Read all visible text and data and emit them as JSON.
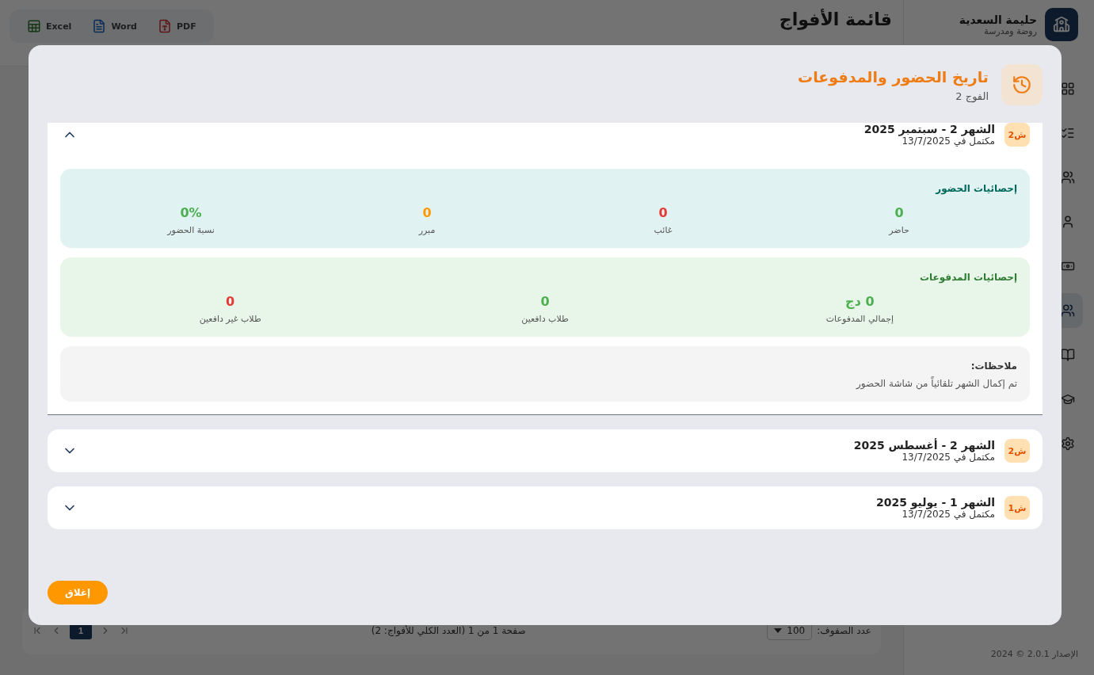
{
  "sidebar": {
    "title": "حليمة السعدية",
    "subtitle": "روضة ومدرسة",
    "items": [
      {
        "selected": false
      },
      {
        "selected": false
      },
      {
        "selected": false
      },
      {
        "selected": false
      },
      {
        "selected": false
      },
      {
        "selected": true
      },
      {
        "selected": false
      },
      {
        "selected": false
      },
      {
        "selected": false
      }
    ],
    "footer": "الإصدار 2.0.1 © 2024"
  },
  "page": {
    "title": "قائمة الأفواج",
    "exports": [
      {
        "label": "PDF",
        "kind": "pdf"
      },
      {
        "label": "Word",
        "kind": "word"
      },
      {
        "label": "Excel",
        "kind": "excel"
      }
    ],
    "pagination": {
      "rows_label": "عدد الصفوف:",
      "rows_value": "100",
      "summary": "صفحة 1 من 1 (العدد الكلي للأفواج: 2)",
      "pages": [
        {
          "label": "1",
          "selected": true
        }
      ]
    }
  },
  "modal": {
    "title": "تاريخ الحضور والمدفوعات",
    "subtitle": "الفوج 2",
    "months": [
      {
        "badge": "ش2",
        "title": "الشهر 2 - سبتمبر 2025",
        "status": "مكتمل في 13/7/2025",
        "expanded": true,
        "sections": [
          {
            "kind": "attendance",
            "title": "إحصائيات الحضور",
            "stats": [
              {
                "value": "0",
                "label": "حاضر",
                "color": "#4caf50"
              },
              {
                "value": "0",
                "label": "غائب",
                "color": "#e53935"
              },
              {
                "value": "0",
                "label": "مبرر",
                "color": "#ff9800"
              },
              {
                "value": "0%",
                "label": "نسبة الحضور",
                "color": "#4caf50"
              }
            ]
          },
          {
            "kind": "payments",
            "title": "إحصائيات المدفوعات",
            "stats": [
              {
                "value": "0 دج",
                "label": "إجمالي المدفوعات",
                "color": "#4caf50"
              },
              {
                "value": "0",
                "label": "طلاب دافعين",
                "color": "#4caf50"
              },
              {
                "value": "0",
                "label": "طلاب غير دافعين",
                "color": "#e53935"
              }
            ]
          },
          {
            "kind": "notes",
            "title": "ملاحظات:",
            "text": "تم إكمال الشهر تلقائياً من شاشة الحضور"
          }
        ]
      },
      {
        "badge": "ش2",
        "title": "الشهر 2 - أغسطس 2025",
        "status": "مكتمل في 13/7/2025",
        "expanded": false
      },
      {
        "badge": "ش1",
        "title": "الشهر 1 - يوليو 2025",
        "status": "مكتمل في 13/7/2025",
        "expanded": false
      }
    ],
    "close": "إغلاق"
  }
}
